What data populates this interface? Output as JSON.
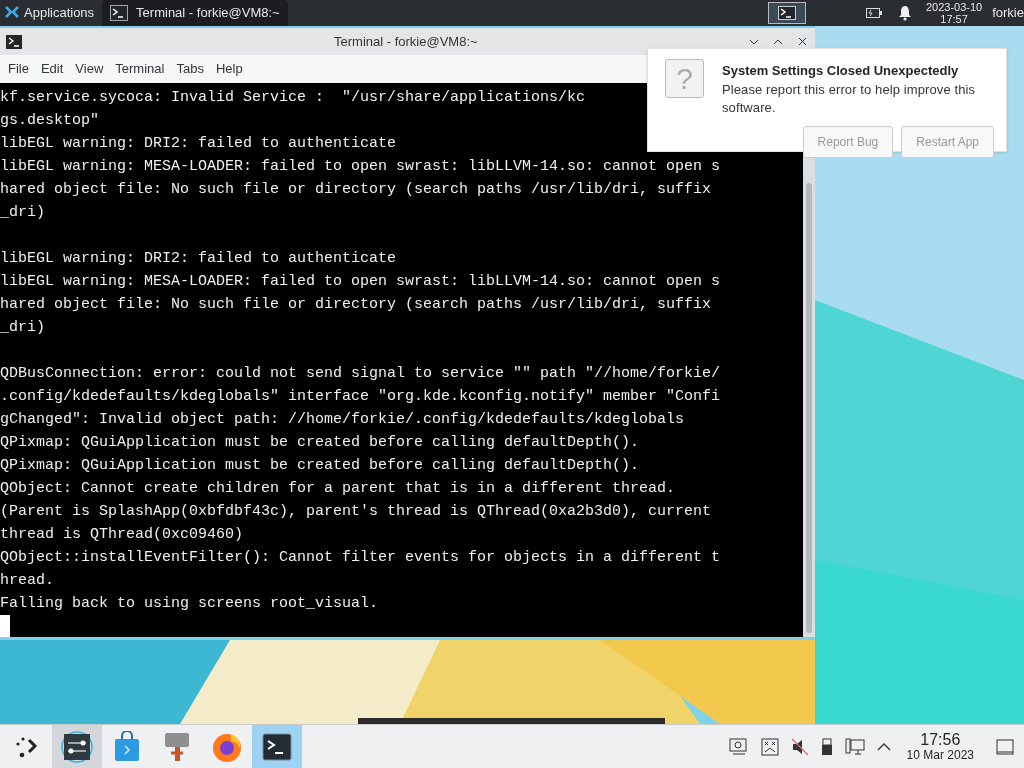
{
  "top_panel": {
    "launcher": "Applications",
    "task": {
      "title": "Terminal - forkie@VM8:~",
      "selected": true
    },
    "date": "2023-03-10",
    "time": "17:57",
    "user": "forkie"
  },
  "window": {
    "title": "Terminal - forkie@VM8:~",
    "menu": [
      "File",
      "Edit",
      "View",
      "Terminal",
      "Tabs",
      "Help"
    ],
    "blocks": [
      [
        "kf.service.sycoca: Invalid Service :  \"/usr/share/applications/kc",
        "gs.desktop\"",
        "libEGL warning: DRI2: failed to authenticate",
        "libEGL warning: MESA-LOADER: failed to open swrast: libLLVM-14.so: cannot open s",
        "hared object file: No such file or directory (search paths /usr/lib/dri, suffix",
        "_dri)"
      ],
      [
        "libEGL warning: DRI2: failed to authenticate",
        "libEGL warning: MESA-LOADER: failed to open swrast: libLLVM-14.so: cannot open s",
        "hared object file: No such file or directory (search paths /usr/lib/dri, suffix",
        "_dri)"
      ],
      [
        "QDBusConnection: error: could not send signal to service \"\" path \"//home/forkie/",
        ".config/kdedefaults/kdeglobals\" interface \"org.kde.kconfig.notify\" member \"Confi",
        "gChanged\": Invalid object path: //home/forkie/.config/kdedefaults/kdeglobals",
        "QPixmap: QGuiApplication must be created before calling defaultDepth().",
        "QPixmap: QGuiApplication must be created before calling defaultDepth().",
        "QObject: Cannot create children for a parent that is in a different thread.",
        "(Parent is SplashApp(0xbfdbf43c), parent's thread is QThread(0xa2b3d0), current",
        "thread is QThread(0xc09460)",
        "QObject::installEventFilter(): Cannot filter events for objects in a different t",
        "hread.",
        "Falling back to using screens root_visual."
      ]
    ]
  },
  "notification": {
    "icon": "?",
    "title": "System Settings Closed Unexpectedly",
    "message": "Please report this error to help improve this software.",
    "buttons": [
      "Report Bug",
      "Restart App"
    ]
  },
  "taskbar": {
    "apps": [
      {
        "kind": "settings",
        "selected": false,
        "hovered": true
      },
      {
        "kind": "store",
        "selected": false,
        "hovered": false
      },
      {
        "kind": "tool",
        "selected": false,
        "hovered": false
      },
      {
        "kind": "browser",
        "selected": false,
        "hovered": false
      },
      {
        "kind": "terminal",
        "selected": true,
        "hovered": false
      }
    ],
    "time": "17:56",
    "date": "10 Mar 2023"
  }
}
